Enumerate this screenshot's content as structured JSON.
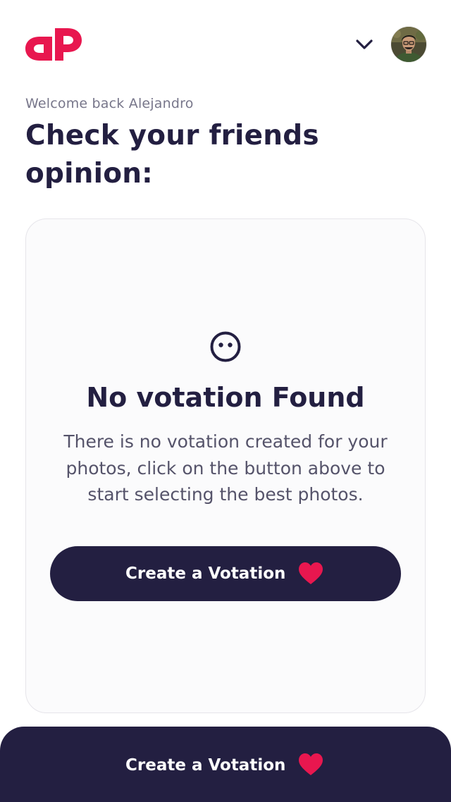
{
  "header": {
    "logo_icon": "dp-brand-logo",
    "menu_icon": "chevron-down-icon",
    "avatar_icon": "user-avatar"
  },
  "welcome_text": "Welcome back Alejandro",
  "page_title": "Check your friends opinion:",
  "empty_state": {
    "icon": "neutral-face-icon",
    "title": "No votation Found",
    "description": "There is no votation created for your photos, click on the button above to start selecting the best photos.",
    "button_label": "Create a Votation",
    "button_icon": "heart-icon"
  },
  "bottom_bar": {
    "label": "Create a Votation",
    "icon": "heart-icon"
  },
  "colors": {
    "brand": "#e8174f",
    "primary_dark": "#231f41",
    "muted_text": "#77768a",
    "card_bg": "#fbfbfc"
  }
}
